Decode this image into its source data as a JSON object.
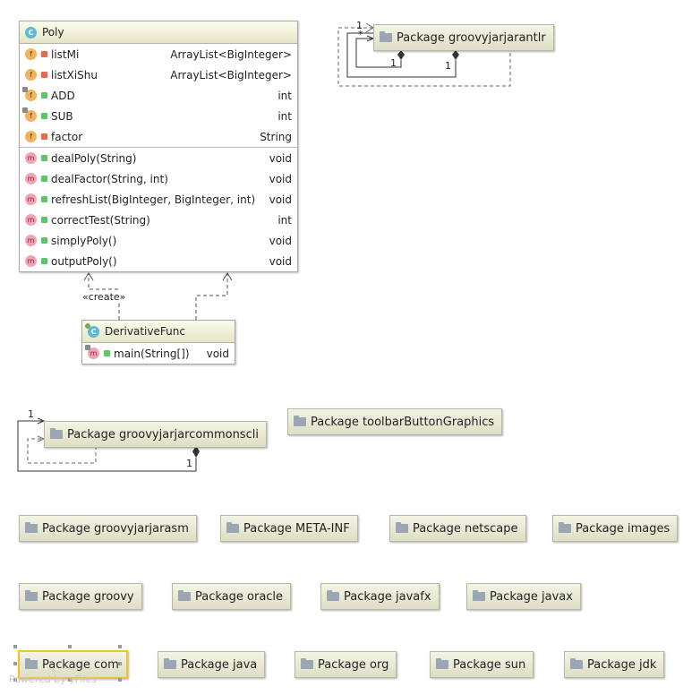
{
  "classes": {
    "poly": {
      "name": "Poly",
      "fields": [
        {
          "name": "listMi",
          "type": "ArrayList<BigInteger>",
          "visibility": "private",
          "static": false
        },
        {
          "name": "listXiShu",
          "type": "ArrayList<BigInteger>",
          "visibility": "private",
          "static": false
        },
        {
          "name": "ADD",
          "type": "int",
          "visibility": "public",
          "static": true
        },
        {
          "name": "SUB",
          "type": "int",
          "visibility": "public",
          "static": true
        },
        {
          "name": "factor",
          "type": "String",
          "visibility": "private",
          "static": false
        }
      ],
      "methods": [
        {
          "name": "dealPoly(String)",
          "type": "void"
        },
        {
          "name": "dealFactor(String, int)",
          "type": "void"
        },
        {
          "name": "refreshList(BigInteger, BigInteger, int)",
          "type": "void"
        },
        {
          "name": "correctTest(String)",
          "type": "int"
        },
        {
          "name": "simplyPoly()",
          "type": "void"
        },
        {
          "name": "outputPoly()",
          "type": "void"
        }
      ]
    },
    "derivative": {
      "name": "DerivativeFunc",
      "methods": [
        {
          "name": "main(String[])",
          "type": "void"
        }
      ]
    }
  },
  "badges": {
    "class": "C",
    "field": "f",
    "method": "m"
  },
  "relations": {
    "create_label": "«create»",
    "antlr_self": {
      "mult_top": "1",
      "star": "*",
      "mult_a": "1",
      "mult_b": "1"
    },
    "cli_self": {
      "mult_top": "1",
      "mult_bottom": "1"
    }
  },
  "packages": [
    "Package groovyjarjarantlr",
    "Package groovyjarjarcommonscli",
    "Package toolbarButtonGraphics",
    "Package groovyjarjarasm",
    "Package META-INF",
    "Package netscape",
    "Package images",
    "Package groovy",
    "Package oracle",
    "Package javafx",
    "Package javax",
    "Package com",
    "Package java",
    "Package org",
    "Package sun",
    "Package jdk"
  ],
  "selected_package": "Package com",
  "watermark": "Powered by yFiles",
  "colors": {
    "header": "#e5e5c9",
    "selection": "#f2c12e",
    "private_lock": "#e26b54",
    "public_lock": "#62c36a"
  }
}
